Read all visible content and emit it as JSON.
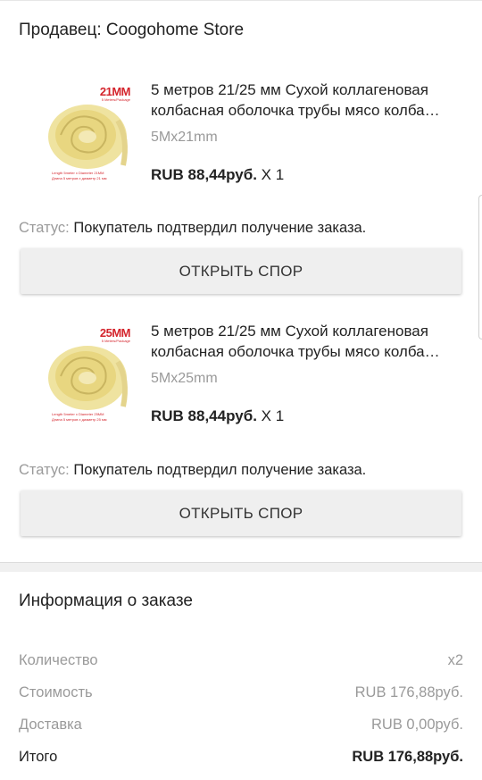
{
  "seller": {
    "label": "Продавец: Coogohome Store"
  },
  "products": [
    {
      "size_badge": "21MM",
      "badge_sub": "5 Meters/Package",
      "caption": "Length 5meter x Diameter 21MM\nДлина 5 метров x диаметр 21 мм",
      "title": "5 метров 21/25 мм Сухой коллагеновая колбасная оболочка трубы мясо колба…",
      "variant": "5Mx21mm",
      "price": "RUB 88,44руб.",
      "qty": "X 1",
      "status_label": "Статус:",
      "status_value": "Покупатель подтвердил получение заказа.",
      "dispute_label": "ОТКРЫТЬ СПОР"
    },
    {
      "size_badge": "25MM",
      "badge_sub": "5 Meters/Package",
      "caption": "Length 5meter x Diameter 25MM\nДлина 5 метров x диаметр 25 мм",
      "title": "5 метров 21/25 мм Сухой коллагеновая колбасная оболочка трубы мясо колба…",
      "variant": "5Mx25mm",
      "price": "RUB 88,44руб.",
      "qty": "X 1",
      "status_label": "Статус:",
      "status_value": "Покупатель подтвердил получение заказа.",
      "dispute_label": "ОТКРЫТЬ СПОР"
    }
  ],
  "order_info": {
    "title": "Информация о заказе",
    "rows": [
      {
        "label": "Количество",
        "value": "x2"
      },
      {
        "label": "Стоимость",
        "value": "RUB 176,88руб."
      },
      {
        "label": "Доставка",
        "value": "RUB 0,00руб."
      },
      {
        "label": "Итого",
        "value": "RUB 176,88руб."
      }
    ]
  },
  "colors": {
    "accent_red": "#d4242c",
    "muted": "#9a9a9a",
    "button_bg": "#efefef"
  }
}
